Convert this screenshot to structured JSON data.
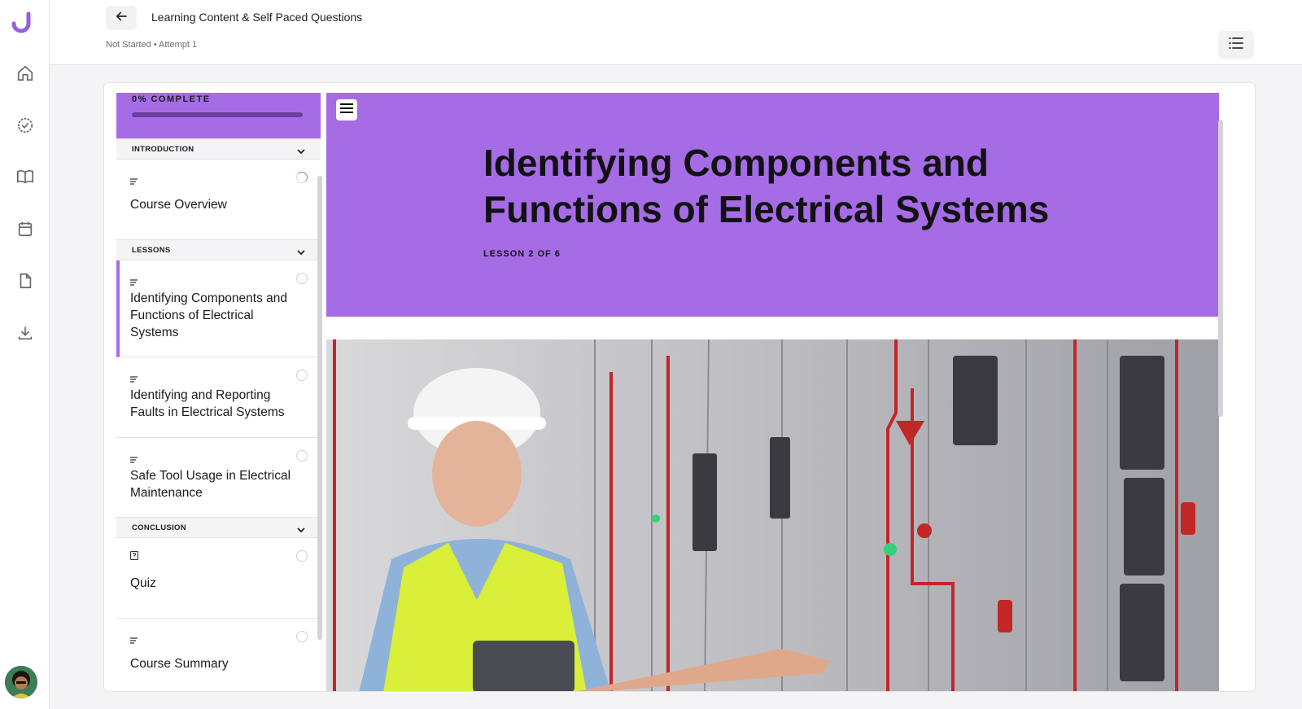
{
  "header": {
    "course_title": "Learning Content & Self Paced Questions",
    "attempt_info": "Not Started • Attempt 1"
  },
  "rail": {
    "icons": [
      "logo-icon",
      "home-icon",
      "check-circle-icon",
      "book-icon",
      "calendar-icon",
      "document-icon",
      "download-icon",
      "avatar"
    ]
  },
  "sidebar": {
    "progress_label": "0% COMPLETE",
    "progress_value": 0,
    "sections": [
      {
        "label": "INTRODUCTION",
        "items": [
          {
            "title": "Course Overview",
            "type": "text",
            "status": "in-progress"
          }
        ]
      },
      {
        "label": "LESSONS",
        "items": [
          {
            "title": "Identifying Components and Functions of Electrical Systems",
            "type": "text",
            "status": "not-started",
            "active": true
          },
          {
            "title": "Identifying and Reporting Faults in Electrical Systems",
            "type": "text",
            "status": "not-started"
          },
          {
            "title": "Safe Tool Usage in Electrical Maintenance",
            "type": "text",
            "status": "not-started"
          }
        ]
      },
      {
        "label": "CONCLUSION",
        "items": [
          {
            "title": "Quiz",
            "type": "quiz",
            "status": "not-started"
          },
          {
            "title": "Course Summary",
            "type": "text",
            "status": "not-started"
          }
        ]
      }
    ]
  },
  "lesson": {
    "title": "Identifying Components and Functions of Electrical Systems",
    "counter": "LESSON 2 OF 6"
  },
  "colors": {
    "accent": "#a66ce6",
    "progress_track": "#6a3fa0"
  }
}
